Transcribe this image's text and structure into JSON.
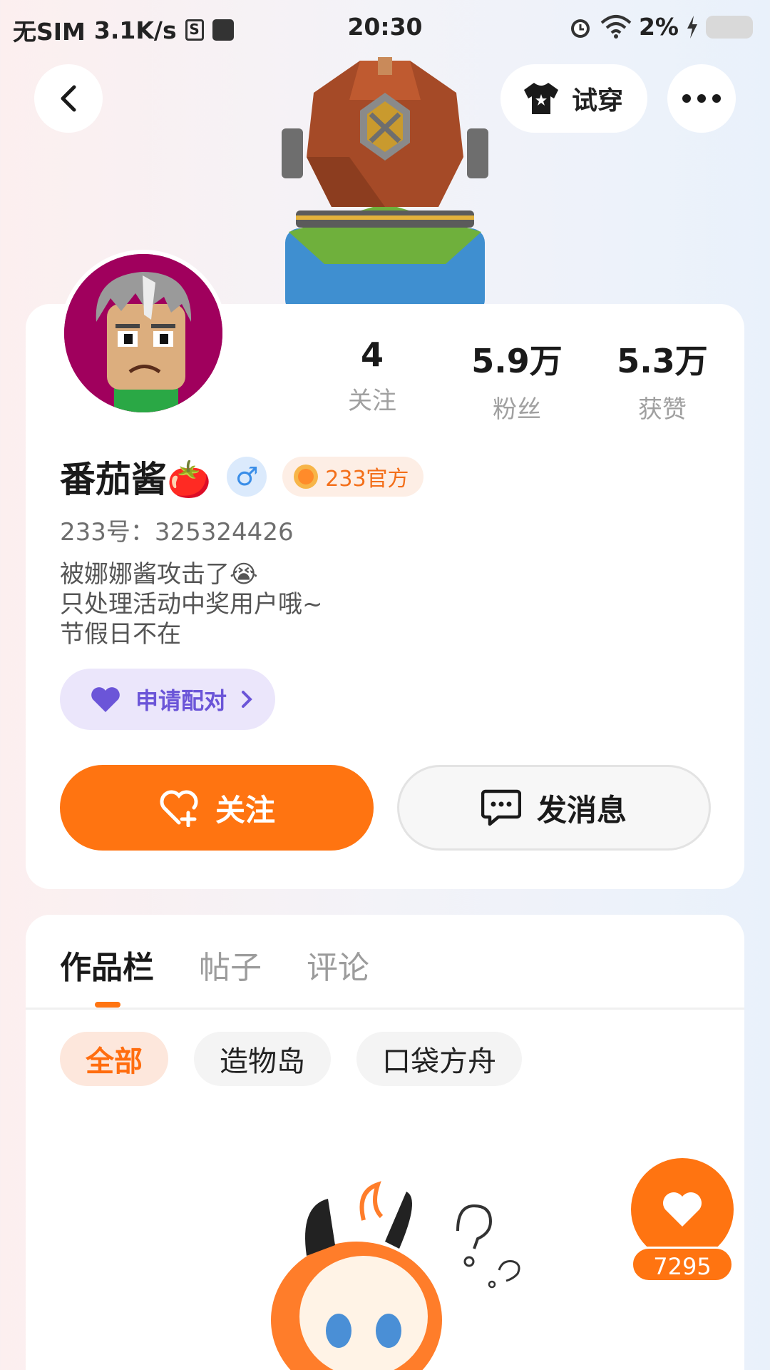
{
  "status_bar": {
    "carrier": "无SIM",
    "speed": "3.1K/s",
    "time": "20:30",
    "battery": "2%"
  },
  "header": {
    "tryon_label": "试穿"
  },
  "profile": {
    "stats": [
      {
        "value": "4",
        "label": "关注"
      },
      {
        "value": "5.9万",
        "label": "粉丝"
      },
      {
        "value": "5.3万",
        "label": "获赞"
      }
    ],
    "name": "番茄酱🍅",
    "gender_symbol": "♂",
    "official_badge": "233官方",
    "uid": "233号：325324426",
    "bio": [
      "被娜娜酱攻击了😭",
      "只处理活动中奖用户哦~",
      "节假日不在"
    ],
    "match_label": "申请配对",
    "follow_label": "关注",
    "message_label": "发消息"
  },
  "tabs": [
    {
      "label": "作品栏",
      "active": true
    },
    {
      "label": "帖子",
      "active": false
    },
    {
      "label": "评论",
      "active": false
    }
  ],
  "filters": [
    {
      "label": "全部",
      "active": true
    },
    {
      "label": "造物岛",
      "active": false
    },
    {
      "label": "口袋方舟",
      "active": false
    }
  ],
  "like_count": "7295",
  "colors": {
    "accent": "#ff7411",
    "match": "#6b55d8",
    "gender": "#3a8ee8"
  }
}
